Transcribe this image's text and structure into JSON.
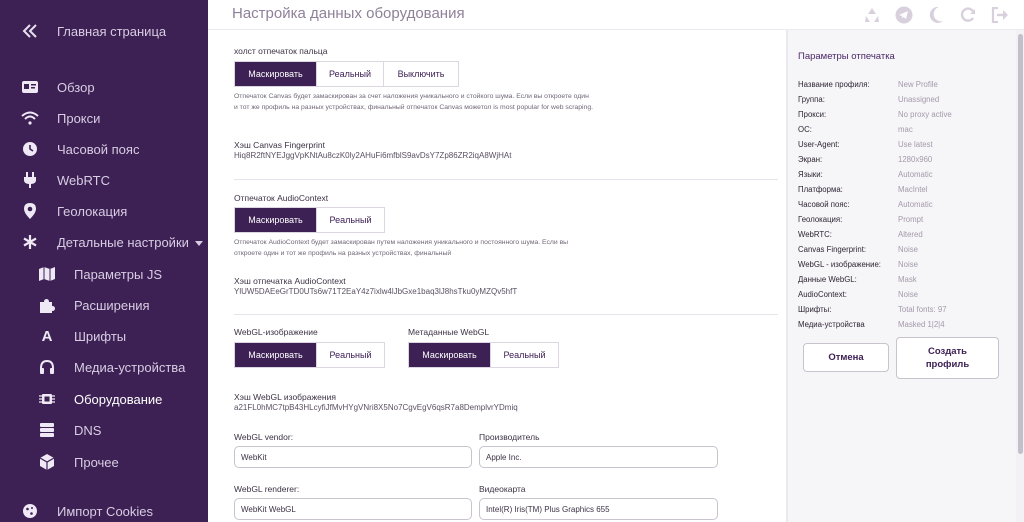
{
  "sidebar": {
    "collapse_icon": "double-chevron-left-icon",
    "items": [
      {
        "label": "Главная страница",
        "icon": "home"
      },
      {
        "label": "Обзор",
        "icon": "id-card"
      },
      {
        "label": "Прокси",
        "icon": "wifi"
      },
      {
        "label": "Часовой пояс",
        "icon": "clock"
      },
      {
        "label": "WebRTC",
        "icon": "plug"
      },
      {
        "label": "Геолокация",
        "icon": "map-pin"
      },
      {
        "label": "Детальные настройки",
        "icon": "asterisk"
      },
      {
        "label": "Параметры JS",
        "icon": "map"
      },
      {
        "label": "Расширения",
        "icon": "puzzle"
      },
      {
        "label": "Шрифты",
        "icon": "font"
      },
      {
        "label": "Медиа-устройства",
        "icon": "headphones"
      },
      {
        "label": "Оборудование",
        "icon": "chip"
      },
      {
        "label": "DNS",
        "icon": "server"
      },
      {
        "label": "Прочее",
        "icon": "box"
      },
      {
        "label": "Импорт Cookies",
        "icon": "cookie"
      }
    ]
  },
  "header": {
    "title": "Настройка данных оборудования",
    "icons": [
      "recycle-icon",
      "telegram-icon",
      "moon-icon",
      "refresh-icon",
      "logout-icon"
    ]
  },
  "canvas": {
    "label": "холст отпечаток пальца",
    "options": [
      "Маскировать",
      "Реальный",
      "Выключить"
    ],
    "description": "Отпечаток Canvas будет замаскирован за счет наложения уникального и стойкого шума. Если вы откроете один и тот же профиль на разных устройствах, финальный отпечаток Canvas можетол is most popular for web scraping.",
    "hash_title": "Хэш Canvas Fingerprint",
    "hash_value": "Hiq8R2ftNYEJggVpKNtAu8czK0ly2AHuFi6mfblS9avDsY7Zp86ZR2iqA8WjHAt"
  },
  "audio": {
    "label": "Отпечаток AudioContext",
    "options": [
      "Маскировать",
      "Реальный"
    ],
    "description": "Отпечаток AudioContext будет замаскирован путем наложения уникального и постоянного шума. Если вы откроете один и тот же профиль на разных устройствах, финальный",
    "hash_title": "Хэш отпечатка AudioContext",
    "hash_value": "YlUW5DAEeGrTD0UTs6w71T2EaY4z7ixlw4lJbGxe1baq3lJ8hsTku0yMZQv5hfT"
  },
  "webgl_image": {
    "label": "WebGL-изображение",
    "options": [
      "Маскировать",
      "Реальный"
    ]
  },
  "webgl_meta": {
    "label": "Метаданные WebGL",
    "options": [
      "Маскировать",
      "Реальный"
    ]
  },
  "webgl_hash": {
    "title": "Хэш WebGL изображения",
    "value": "a21FL0hMC7tpB43HLcyfiJfMvHYgVNri8X5No7CgvEgV6qsR7a8DemplvrYDmiq"
  },
  "webgl_vendor": {
    "label": "WebGL vendor:",
    "value": "WebKit"
  },
  "manufacturer": {
    "label": "Производитель",
    "value": "Apple Inc."
  },
  "webgl_renderer": {
    "label": "WebGL renderer:",
    "value": "WebKit WebGL"
  },
  "gpu": {
    "label": "Видеокарта",
    "value": "Intel(R) Iris(TM) Plus Graphics 655"
  },
  "summary": {
    "title": "Параметры отпечатка",
    "rows": [
      {
        "key": "Название профиля:",
        "value": "New Profile"
      },
      {
        "key": "Группа:",
        "value": "Unassigned"
      },
      {
        "key": "Прокси:",
        "value": "No proxy active"
      },
      {
        "key": "ОС:",
        "value": "mac"
      },
      {
        "key": "User-Agent:",
        "value": "Use latest"
      },
      {
        "key": "Экран:",
        "value": "1280x960"
      },
      {
        "key": "Языки:",
        "value": "Automatic"
      },
      {
        "key": "Платформа:",
        "value": "MacIntel"
      },
      {
        "key": "Часовой пояс:",
        "value": "Automatic"
      },
      {
        "key": "Геолокация:",
        "value": "Prompt"
      },
      {
        "key": "WebRTC:",
        "value": "Altered"
      },
      {
        "key": "Canvas Fingerprint:",
        "value": "Noise"
      },
      {
        "key": "WebGL - изображение:",
        "value": "Noise"
      },
      {
        "key": "Данные WebGL:",
        "value": "Mask"
      },
      {
        "key": "AudioContext:",
        "value": "Noise"
      },
      {
        "key": "Шрифты:",
        "value": "Total fonts: 97"
      },
      {
        "key": "Медиа-устройства",
        "value": "Masked 1|2|4"
      }
    ],
    "cancel_label": "Отмена",
    "create_label": "Создать профиль"
  }
}
